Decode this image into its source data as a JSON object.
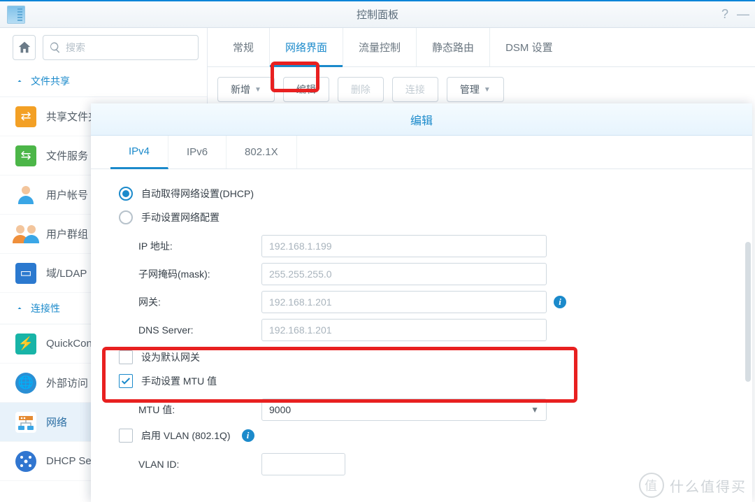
{
  "window": {
    "title": "控制面板"
  },
  "search": {
    "placeholder": "搜索"
  },
  "groups": {
    "file_share": "文件共享",
    "connectivity": "连接性"
  },
  "sidebar": {
    "share_folder": "共享文件夹",
    "file_service": "文件服务",
    "user_account": "用户帐号",
    "user_group": "用户群组",
    "domain_ldap": "域/LDAP",
    "quickconnect": "QuickConnect",
    "external_access": "外部访问",
    "network": "网络",
    "dhcp": "DHCP Server"
  },
  "tabs": {
    "general": "常规",
    "net_iface": "网络界面",
    "flow": "流量控制",
    "route": "静态路由",
    "dsm": "DSM 设置"
  },
  "toolbar": {
    "add": "新增",
    "edit": "编辑",
    "delete": "删除",
    "connect": "连接",
    "manage": "管理"
  },
  "modal": {
    "title": "编辑",
    "tabs": {
      "ipv4": "IPv4",
      "ipv6": "IPv6",
      "dot1x": "802.1X"
    },
    "radio_dhcp": "自动取得网络设置(DHCP)",
    "radio_manual": "手动设置网络配置",
    "labels": {
      "ip": "IP 地址:",
      "mask": "子网掩码(mask):",
      "gateway": "网关:",
      "dns": "DNS Server:",
      "default_gw": "设为默认网关",
      "mtu_manual": "手动设置 MTU 值",
      "mtu": "MTU 值:",
      "vlan_enable": "启用 VLAN (802.1Q)",
      "vlan_id": "VLAN ID:"
    },
    "values": {
      "ip": "192.168.1.199",
      "mask": "255.255.255.0",
      "gateway": "192.168.1.201",
      "dns": "192.168.1.201",
      "mtu": "9000"
    }
  },
  "watermark": "什么值得买"
}
